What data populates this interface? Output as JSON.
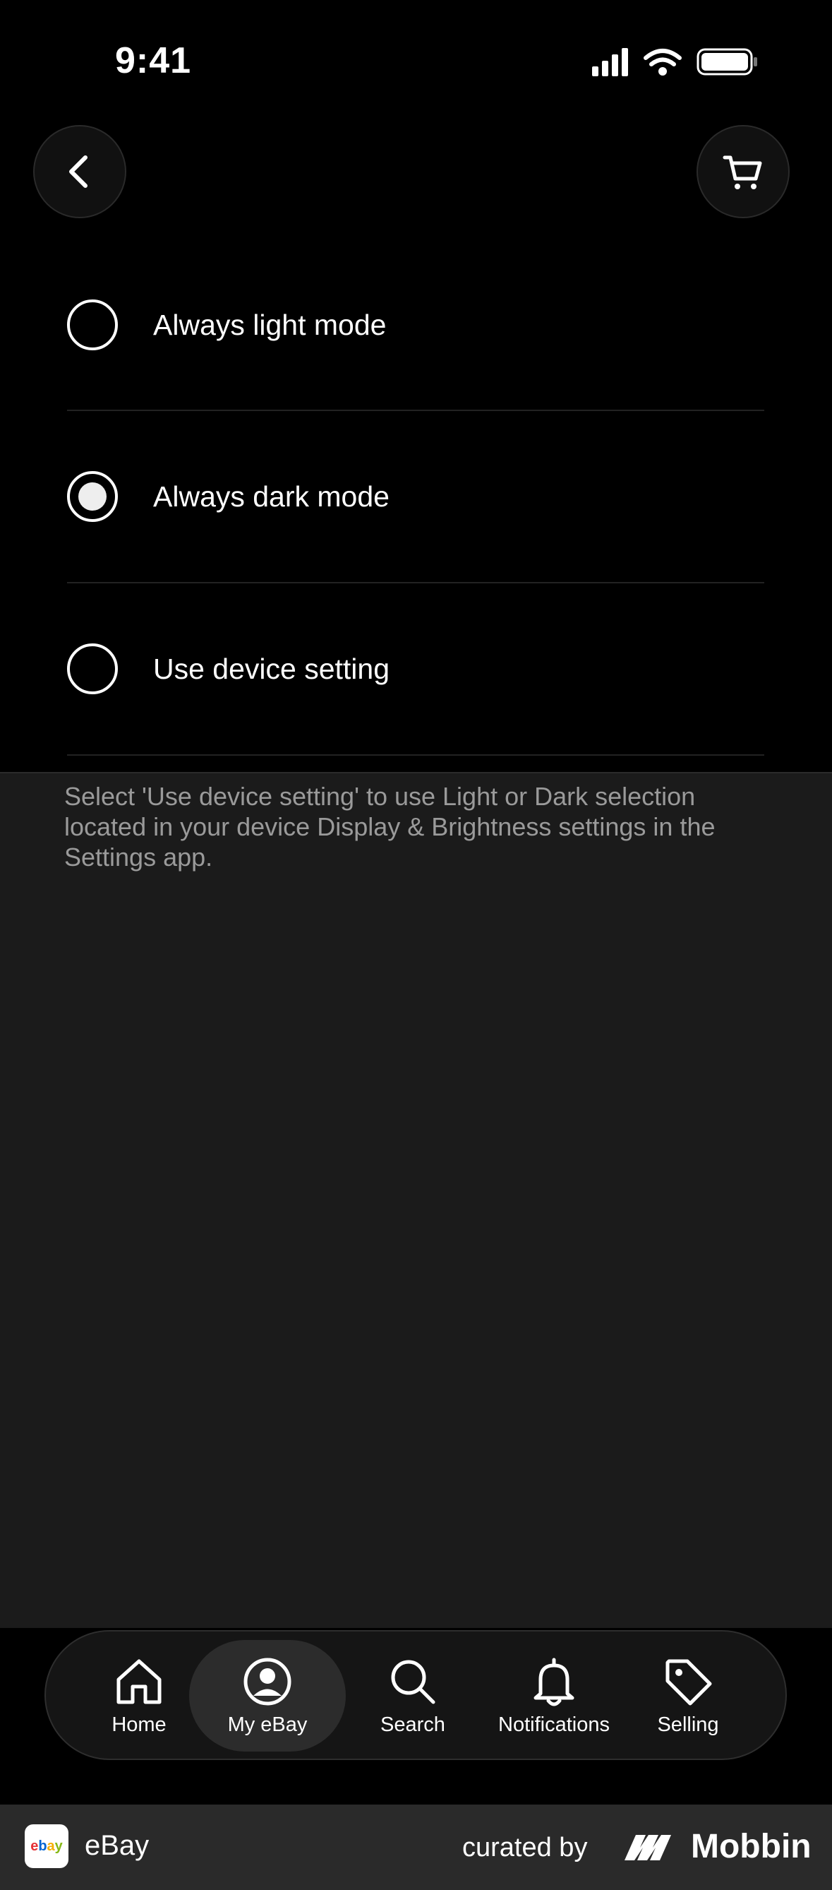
{
  "status": {
    "time": "9:41"
  },
  "options": [
    {
      "label": "Always light mode",
      "selected": false
    },
    {
      "label": "Always dark mode",
      "selected": true
    },
    {
      "label": "Use device setting",
      "selected": false
    }
  ],
  "hint": "Select 'Use device setting' to use Light or Dark selection located in your device Display & Brightness settings in the Settings app.",
  "tabs": [
    {
      "label": "Home",
      "icon": "home-icon"
    },
    {
      "label": "My eBay",
      "icon": "profile-icon",
      "active": true
    },
    {
      "label": "Search",
      "icon": "search-icon"
    },
    {
      "label": "Notifications",
      "icon": "bell-icon"
    },
    {
      "label": "Selling",
      "icon": "tag-icon"
    }
  ],
  "footer": {
    "app_name": "eBay",
    "logo_text": "ebay",
    "curated": "curated by",
    "brand": "Mobbin"
  },
  "colors": {
    "background": "#1b1b1b",
    "top_background": "#000000",
    "hint_text": "#9a9a9a",
    "active_tab": "#2c2c2c"
  }
}
